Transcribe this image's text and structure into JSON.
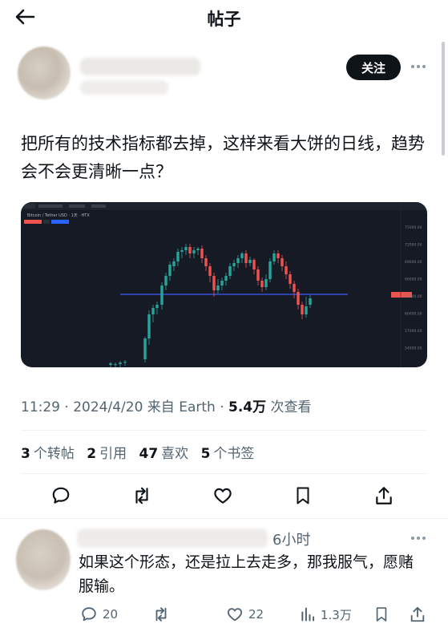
{
  "header": {
    "title": "帖子",
    "back_icon": "arrow-left-icon"
  },
  "author": {
    "follow_label": "关注",
    "more_icon": "more-horizontal-icon"
  },
  "post": {
    "text": "把所有的技术指标都去掉，这样来看大饼的日线，趋势会不会更清晰一点？",
    "chart": {
      "pair": "Bitcoin / Tether USD · 1天 · HTX",
      "axis_prices": [
        "75000.00",
        "72000.00",
        "69000.00",
        "66000.00",
        "63000.00",
        "60000.00",
        "57000.00",
        "54000.00"
      ]
    },
    "meta": {
      "time": "11:29",
      "date": "2024/4/20",
      "source": "来自 Earth",
      "views_count": "5.4万",
      "views_label": "次查看"
    }
  },
  "stats": {
    "reposts_count": "3",
    "reposts_label": "个转帖",
    "quotes_count": "2",
    "quotes_label": "引用",
    "likes_count": "47",
    "likes_label": "喜欢",
    "bookmarks_count": "5",
    "bookmarks_label": "个书签"
  },
  "reply": {
    "time": "6小时",
    "text": "如果这个形态，还是拉上去走多，那我服气，愿赌服输。",
    "replies_count": "20",
    "likes_count": "22",
    "views_count": "1.3万"
  },
  "colors": {
    "up": "#26a69a",
    "down": "#ef5350",
    "chart_bg": "#161a25",
    "follow_bg": "#0f1419",
    "muted": "#536471"
  }
}
